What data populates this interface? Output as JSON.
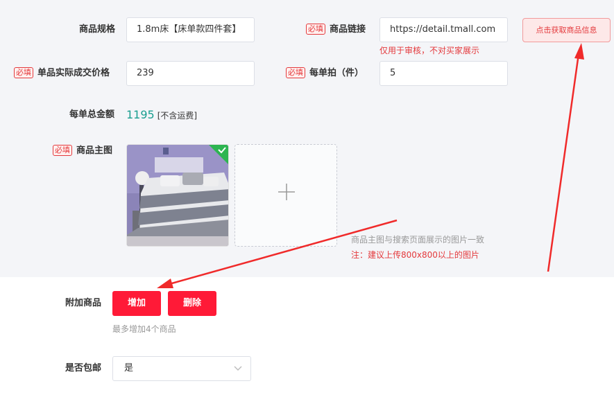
{
  "form": {
    "spec": {
      "label": "商品规格",
      "value": "1.8m床【床单款四件套】"
    },
    "link": {
      "required": "必填",
      "label": "商品链接",
      "value": "https://detail.tmall.com",
      "fetch_button": "点击获取商品信息",
      "note": "仅用于审核，不对买家展示"
    },
    "price": {
      "required": "必填",
      "label": "单品实际成交价格",
      "value": "239"
    },
    "qty": {
      "required": "必填",
      "label": "每单拍（件）",
      "value": "5"
    },
    "total": {
      "label": "每单总金额",
      "value": "1195",
      "unit": "[不含运费]"
    },
    "main_image": {
      "required": "必填",
      "label": "商品主图",
      "note1": "商品主图与搜索页面展示的图片一致",
      "note2": "注：建议上传800x800以上的图片"
    },
    "extra": {
      "label": "附加商品",
      "add_button": "增加",
      "delete_button": "删除",
      "hint": "最多增加4个商品"
    },
    "shipping": {
      "label": "是否包邮",
      "selected": "是"
    }
  },
  "colors": {
    "primary_red": "#ff1a37",
    "accent_red": "#e4393c",
    "teal_total": "#1a9e8f",
    "panel_bg": "#f4f5f8",
    "upload_check": "#2db551"
  }
}
